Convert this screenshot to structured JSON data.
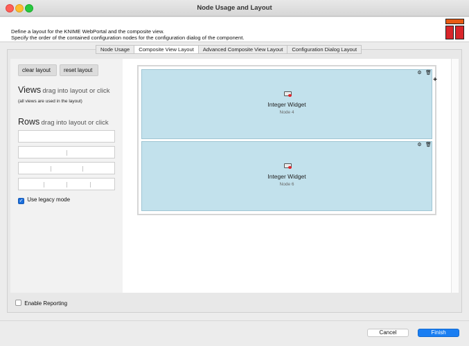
{
  "window": {
    "title": "Node Usage and Layout"
  },
  "header": {
    "line1": "Define a layout for the KNIME WebPortal and the composite view.",
    "line2": "Specify the order of the contained configuration nodes for the configuration dialog of the component.",
    "logo_icon": "knime-logo-icon"
  },
  "tabs": [
    {
      "label": "Node Usage",
      "active": false
    },
    {
      "label": "Composite View Layout",
      "active": true
    },
    {
      "label": "Advanced Composite View Layout",
      "active": false
    },
    {
      "label": "Configuration Dialog Layout",
      "active": false
    }
  ],
  "left_panel": {
    "clear_label": "clear layout",
    "reset_label": "reset layout",
    "views_title": "Views",
    "views_hint": "drag into layout or click",
    "views_note": "(all views are used in the layout)",
    "rows_title": "Rows",
    "rows_hint": "drag into layout or click",
    "legacy_label": "Use legacy mode",
    "legacy_checked": true
  },
  "layout": {
    "cells": [
      {
        "title": "Integer Widget",
        "subtitle": "Node 4"
      },
      {
        "title": "Integer Widget",
        "subtitle": "Node 6"
      }
    ],
    "add_symbol": "+"
  },
  "reporting": {
    "label": "Enable Reporting",
    "checked": false
  },
  "footer": {
    "cancel_label": "Cancel",
    "finish_label": "Finish"
  },
  "colors": {
    "accent": "#1a7ef2",
    "cell_bg": "#c2e1ec",
    "logo_orange": "#e85a13",
    "logo_red": "#d9262b"
  }
}
